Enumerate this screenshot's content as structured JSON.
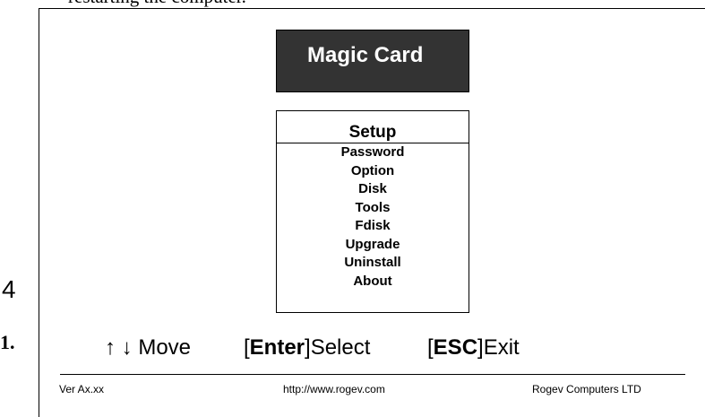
{
  "document": {
    "cut_text": "restarting the computer."
  },
  "screen": {
    "brand_title": "Magic Card",
    "setup_title": "Setup",
    "menu_items": [
      "Password",
      "Option",
      "Disk",
      "Tools",
      "Fdisk",
      "Upgrade",
      "Uninstall",
      "About"
    ],
    "stray_marks": {
      "four": "4",
      "one": "1."
    },
    "keys": {
      "arrows": "↑ ↓",
      "move_label": " Move",
      "enter_open": "[",
      "enter_key": "Enter",
      "enter_close": "]",
      "enter_label": "Select",
      "esc_open": "[",
      "esc_key": "ESC",
      "esc_close": "]",
      "esc_label": "Exit"
    },
    "footer": {
      "version": "Ver Ax.xx",
      "url": "http://www.rogev.com",
      "company": "Rogev Computers LTD"
    }
  }
}
